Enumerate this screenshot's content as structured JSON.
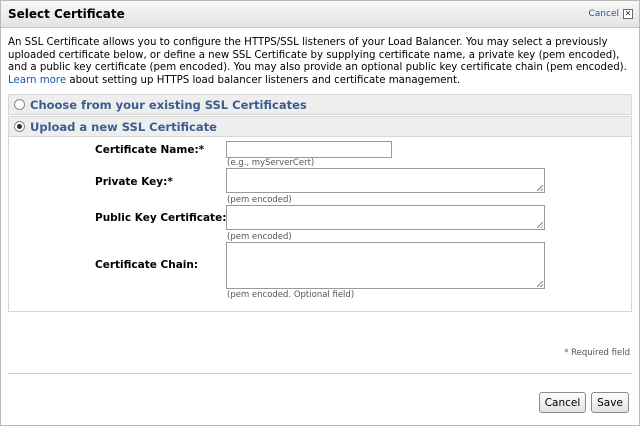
{
  "dialog": {
    "title": "Select Certificate",
    "cancel_link": "Cancel",
    "close_glyph": "✕"
  },
  "intro": {
    "text_before_link": "An SSL Certificate allows you to configure the HTTPS/SSL listeners of your Load Balancer. You may select a previously uploaded certificate below, or define a new SSL Certificate by supplying certificate name, a private key (pem encoded), and a public key certificate (pem encoded). You may also provide an optional public key certificate chain (pem encoded). ",
    "link_text": "Learn more",
    "text_after_link": " about setting up HTTPS load balancer listeners and certificate management."
  },
  "options": {
    "existing_label": "Choose from your existing SSL Certificates",
    "upload_label": "Upload a new SSL Certificate",
    "selected": "upload"
  },
  "form": {
    "cert_name_label": "Certificate Name:*",
    "cert_name_hint": "(e.g., myServerCert)",
    "cert_name_value": "",
    "private_key_label": "Private Key:*",
    "private_key_hint": "(pem encoded)",
    "public_cert_label": "Public Key Certificate:*",
    "public_cert_hint": "(pem encoded)",
    "chain_label": "Certificate Chain:",
    "chain_hint": "(pem encoded. Optional field)"
  },
  "footer": {
    "required_note": "* Required field",
    "cancel_button": "Cancel",
    "save_button": "Save"
  }
}
